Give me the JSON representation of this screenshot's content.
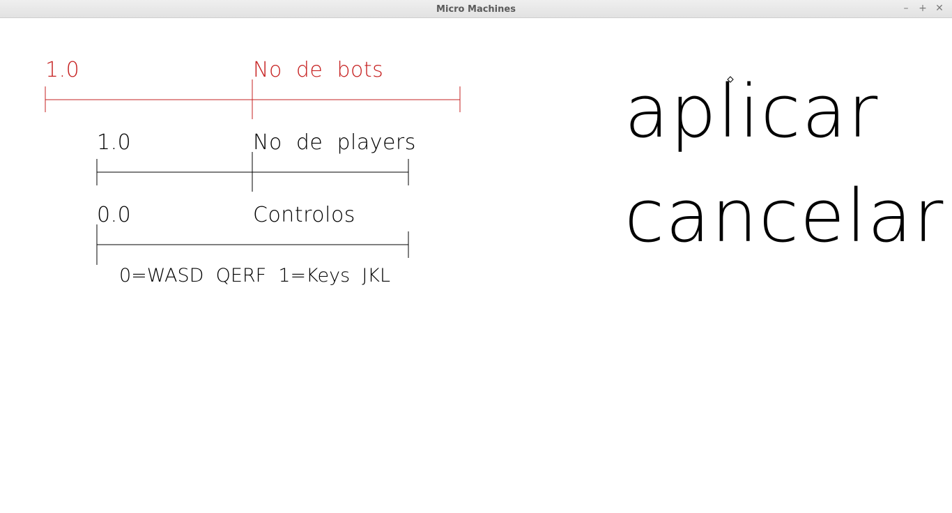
{
  "window": {
    "title": "Micro Machines",
    "controls": {
      "minimize": "–",
      "maximize": "+",
      "close": "✕"
    }
  },
  "sliders": [
    {
      "value": "1.0",
      "title": "No  de  bots",
      "color": "#c62020",
      "selected": true
    },
    {
      "value": "1.0",
      "title": "No  de  players",
      "color": "#000000",
      "selected": false
    },
    {
      "value": "0.0",
      "title": "Controlos",
      "color": "#000000",
      "selected": false,
      "hint": "0=WASD  QERF  1=Keys  JKL"
    }
  ],
  "buttons": {
    "apply": "aplicar",
    "cancel": "cancelar"
  },
  "cursor": {
    "icon": "diamond-cursor-icon"
  }
}
